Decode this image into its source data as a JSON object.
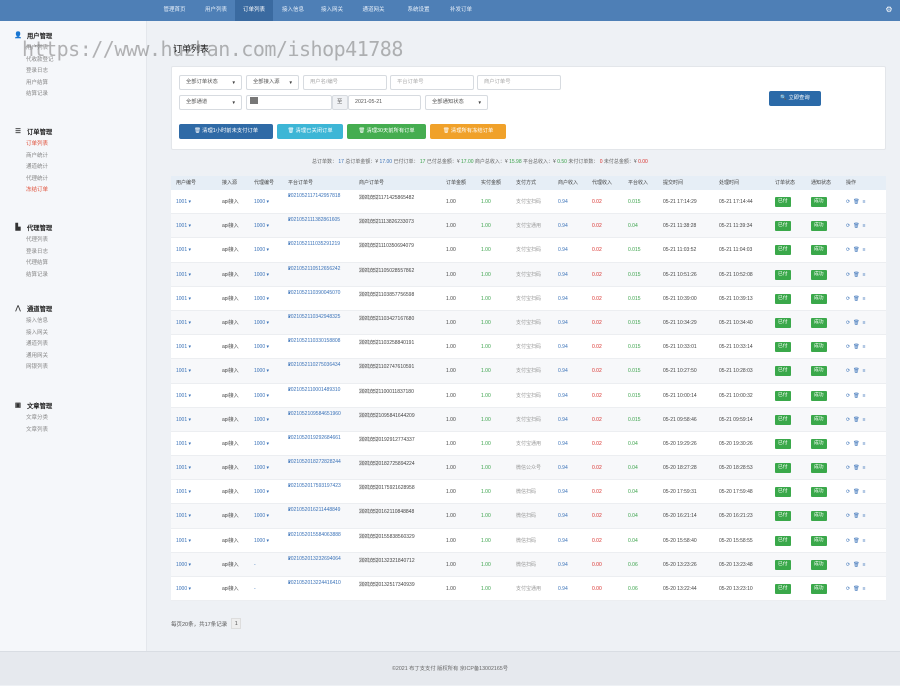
{
  "topnav": {
    "items": [
      {
        "label": "管理首页",
        "active": false
      },
      {
        "label": "用户列表",
        "active": false
      },
      {
        "label": "订单列表",
        "active": true
      },
      {
        "label": "接入信息",
        "active": false
      },
      {
        "label": "接入网关",
        "active": false
      },
      {
        "label": "通道网关",
        "active": false
      },
      {
        "label": "系统设置",
        "active": false
      },
      {
        "label": "补发订单",
        "active": false
      }
    ],
    "settings_icon": "gear-icon"
  },
  "sidebar": {
    "sections": [
      {
        "title": "用户管理",
        "icon": "user-icon",
        "items": [
          {
            "label": "用户列表",
            "current": false
          },
          {
            "label": "代收款登记",
            "current": false
          },
          {
            "label": "登录日志",
            "current": false
          },
          {
            "label": "用户结算",
            "current": false
          },
          {
            "label": "结算记录",
            "current": false
          }
        ]
      },
      {
        "title": "订单管理",
        "icon": "list-icon",
        "items": [
          {
            "label": "订单列表",
            "current": true
          },
          {
            "label": "商户统计",
            "current": false
          },
          {
            "label": "通道统计",
            "current": false
          },
          {
            "label": "代理统计",
            "current": false
          },
          {
            "label": "冻结订单",
            "current": true
          }
        ]
      },
      {
        "title": "代理管理",
        "icon": "document-icon",
        "items": [
          {
            "label": "代理列表",
            "current": false
          },
          {
            "label": "登录日志",
            "current": false
          },
          {
            "label": "代理结算",
            "current": false
          },
          {
            "label": "结算记录",
            "current": false
          }
        ]
      },
      {
        "title": "通道管理",
        "icon": "road-icon",
        "items": [
          {
            "label": "接入信息",
            "current": false
          },
          {
            "label": "接入网关",
            "current": false
          },
          {
            "label": "通道列表",
            "current": false
          },
          {
            "label": "通用网关",
            "current": false
          },
          {
            "label": "网银列表",
            "current": false
          }
        ]
      },
      {
        "title": "文章管理",
        "icon": "book-icon",
        "items": [
          {
            "label": "文章分类",
            "current": false
          },
          {
            "label": "文章列表",
            "current": false
          }
        ]
      }
    ]
  },
  "watermark": "https://www.huzhan.com/ishop41788",
  "page_title": "订单列表",
  "filters": {
    "order_status": "全部订单状态",
    "access_type": "全部接入源",
    "user_placeholder": "用户名/编号",
    "platform_no_placeholder": "平台订单号",
    "merchant_no_placeholder": "商户订单号",
    "channel": "全部通道",
    "date_from": "",
    "date_sep": "至",
    "date_to": "2021-05-21",
    "notify_status": "全部通知状态",
    "query_button": "立即查询",
    "query_icon": "search-icon"
  },
  "cleanup_buttons": [
    {
      "label": "清理1小时前未支付订单",
      "color": "#2f6aa6",
      "icon": "trash-icon"
    },
    {
      "label": "清理已关闭订单",
      "color": "#3db6d6",
      "icon": "trash-icon"
    },
    {
      "label": "清理30天前所有订单",
      "color": "#45ad50",
      "icon": "trash-icon"
    },
    {
      "label": "清理所有冻结订单",
      "color": "#f0a12a",
      "icon": "trash-icon"
    }
  ],
  "stats": [
    {
      "label": "总订单数：",
      "value": "17",
      "color": "#3a72b8"
    },
    {
      "label": "总订单金额：¥",
      "value": "17.00",
      "color": "#3a72b8"
    },
    {
      "label": "已付订单：",
      "value": "17",
      "color": "#3aa24a"
    },
    {
      "label": "已付总金额：¥",
      "value": "17.00",
      "color": "#3aa24a"
    },
    {
      "label": "商户总收入：¥",
      "value": "15.98",
      "color": "#3aa24a"
    },
    {
      "label": "平台总收入：¥",
      "value": "0.50",
      "color": "#3aa24a"
    },
    {
      "label": "未付订单数：",
      "value": "0",
      "color": "#d9302c"
    },
    {
      "label": "未付总金额：¥",
      "value": "0.00",
      "color": "#d9302c"
    }
  ],
  "table": {
    "headers": [
      "用户编号",
      "接入源",
      "代理编号",
      "平台订单号",
      "商户订单号",
      "订单金额",
      "实付金额",
      "支付方式",
      "商户收入",
      "代理收入",
      "平台收入",
      "提交时间",
      "处理时间",
      "订单状态",
      "通知状态",
      "操作"
    ],
    "rows": [
      {
        "user": "1001 ▾",
        "src": "api接入",
        "agent": "1000 ▾",
        "pno": "20210521171429578​18",
        "pno1": "2021052117142957818",
        "mno1": "20210521171425865482",
        "mno2": "测试支付",
        "amt": "1.00",
        "paid": "1.00",
        "pay": "支付宝扫码",
        "minc": "0.94",
        "ainc": "0.02",
        "pinc": "0.015",
        "sub": "05-21 17:14:29",
        "proc": "05-21 17:14:44",
        "status": "已付",
        "notify": "成功"
      },
      {
        "user": "1001 ▾",
        "src": "api接入",
        "agent": "1000 ▾",
        "pno1": "2021052111382861605",
        "mno1": "20210521113826233073",
        "mno2": "测试支付",
        "amt": "1.00",
        "paid": "1.00",
        "pay": "支付宝通用",
        "minc": "0.94",
        "ainc": "0.02",
        "pinc": "0.04",
        "sub": "05-21 11:38:28",
        "proc": "05-21 11:39:34",
        "status": "已付",
        "notify": "成功"
      },
      {
        "user": "1001 ▾",
        "src": "api接入",
        "agent": "1000 ▾",
        "pno1": "2021052111035291219",
        "mno1": "20210521110350694079",
        "mno2": "测试支付",
        "amt": "1.00",
        "paid": "1.00",
        "pay": "支付宝扫码",
        "minc": "0.94",
        "ainc": "0.02",
        "pinc": "0.015",
        "sub": "05-21 11:03:52",
        "proc": "05-21 11:04:03",
        "status": "已付",
        "notify": "成功"
      },
      {
        "user": "1001 ▾",
        "src": "api接入",
        "agent": "1000 ▾",
        "pno1": "2021052110512656242",
        "mno1": "20210521105028557862",
        "mno2": "测试支付",
        "amt": "1.00",
        "paid": "1.00",
        "pay": "支付宝扫码",
        "minc": "0.94",
        "ainc": "0.02",
        "pinc": "0.015",
        "sub": "05-21 10:51:26",
        "proc": "05-21 10:52:08",
        "status": "已付",
        "notify": "成功"
      },
      {
        "user": "1001 ▾",
        "src": "api接入",
        "agent": "1000 ▾",
        "pno1": "2021052110390045070",
        "mno1": "20210521103857756598",
        "mno2": "测试支付",
        "amt": "1.00",
        "paid": "1.00",
        "pay": "支付宝扫码",
        "minc": "0.94",
        "ainc": "0.02",
        "pinc": "0.015",
        "sub": "05-21 10:39:00",
        "proc": "05-21 10:39:13",
        "status": "已付",
        "notify": "成功"
      },
      {
        "user": "1001 ▾",
        "src": "api接入",
        "agent": "1000 ▾",
        "pno1": "2021052110342948325",
        "mno1": "20210521103427167680",
        "mno2": "测试支付",
        "amt": "1.00",
        "paid": "1.00",
        "pay": "支付宝扫码",
        "minc": "0.94",
        "ainc": "0.02",
        "pinc": "0.015",
        "sub": "05-21 10:34:29",
        "proc": "05-21 10:34:40",
        "status": "已付",
        "notify": "成功"
      },
      {
        "user": "1001 ▾",
        "src": "api接入",
        "agent": "1000 ▾",
        "pno1": "2021052110330158808",
        "mno1": "20210521103258840191",
        "mno2": "测试支付",
        "amt": "1.00",
        "paid": "1.00",
        "pay": "支付宝扫码",
        "minc": "0.94",
        "ainc": "0.02",
        "pinc": "0.015",
        "sub": "05-21 10:33:01",
        "proc": "05-21 10:33:14",
        "status": "已付",
        "notify": "成功"
      },
      {
        "user": "1001 ▾",
        "src": "api接入",
        "agent": "1000 ▾",
        "pno1": "2021052110275036434",
        "mno1": "20210521102747610591",
        "mno2": "测试支付",
        "amt": "1.00",
        "paid": "1.00",
        "pay": "支付宝扫码",
        "minc": "0.94",
        "ainc": "0.02",
        "pinc": "0.015",
        "sub": "05-21 10:27:50",
        "proc": "05-21 10:28:03",
        "status": "已付",
        "notify": "成功"
      },
      {
        "user": "1001 ▾",
        "src": "api接入",
        "agent": "1000 ▾",
        "pno1": "2021052110001489310",
        "mno1": "20210521100011837180",
        "mno2": "测试支付",
        "amt": "1.00",
        "paid": "1.00",
        "pay": "支付宝扫码",
        "minc": "0.94",
        "ainc": "0.02",
        "pinc": "0.015",
        "sub": "05-21 10:00:14",
        "proc": "05-21 10:00:32",
        "status": "已付",
        "notify": "成功"
      },
      {
        "user": "1001 ▾",
        "src": "api接入",
        "agent": "1000 ▾",
        "pno1": "2021052109584651960",
        "mno1": "20210521095841644209",
        "mno2": "测试支付",
        "amt": "1.00",
        "paid": "1.00",
        "pay": "支付宝扫码",
        "minc": "0.94",
        "ainc": "0.02",
        "pinc": "0.015",
        "sub": "05-21 09:58:46",
        "proc": "05-21 09:59:14",
        "status": "已付",
        "notify": "成功"
      },
      {
        "user": "1001 ▾",
        "src": "api接入",
        "agent": "1000 ▾",
        "pno1": "2021052019292684661",
        "mno1": "20210520192912774337",
        "mno2": "测试支付",
        "amt": "1.00",
        "paid": "1.00",
        "pay": "支付宝通用",
        "minc": "0.94",
        "ainc": "0.02",
        "pinc": "0.04",
        "sub": "05-20 19:29:26",
        "proc": "05-20 19:30:26",
        "status": "已付",
        "notify": "成功"
      },
      {
        "user": "1001 ▾",
        "src": "api接入",
        "agent": "1000 ▾",
        "pno1": "2021052018272828244",
        "mno1": "20210520182725894224",
        "mno2": "测试支付",
        "amt": "1.00",
        "paid": "1.00",
        "pay": "微信公众号",
        "minc": "0.94",
        "ainc": "0.02",
        "pinc": "0.04",
        "sub": "05-20 18:27:28",
        "proc": "05-20 18:28:53",
        "status": "已付",
        "notify": "成功"
      },
      {
        "user": "1001 ▾",
        "src": "api接入",
        "agent": "1000 ▾",
        "pno1": "2021052017593197423",
        "mno1": "20210520175921628958",
        "mno2": "测试支付",
        "amt": "1.00",
        "paid": "1.00",
        "pay": "微信扫码",
        "minc": "0.94",
        "ainc": "0.02",
        "pinc": "0.04",
        "sub": "05-20 17:59:31",
        "proc": "05-20 17:59:48",
        "status": "已付",
        "notify": "成功"
      },
      {
        "user": "1001 ▾",
        "src": "api接入",
        "agent": "1000 ▾",
        "pno1": "2021052016211448849",
        "mno1": "20210520162110848848",
        "mno2": "测试支付",
        "amt": "1.00",
        "paid": "1.00",
        "pay": "微信扫码",
        "minc": "0.94",
        "ainc": "0.02",
        "pinc": "0.04",
        "sub": "05-20 16:21:14",
        "proc": "05-20 16:21:23",
        "status": "已付",
        "notify": "成功"
      },
      {
        "user": "1001 ▾",
        "src": "api接入",
        "agent": "1000 ▾",
        "pno1": "2021052015584063888",
        "mno1": "20210520155838560329",
        "mno2": "测试支付",
        "amt": "1.00",
        "paid": "1.00",
        "pay": "微信扫码",
        "minc": "0.94",
        "ainc": "0.02",
        "pinc": "0.04",
        "sub": "05-20 15:58:40",
        "proc": "05-20 15:58:55",
        "status": "已付",
        "notify": "成功"
      },
      {
        "user": "1000 ▾",
        "src": "api接入",
        "agent": "-",
        "pno1": "2021052013232694064",
        "mno1": "20210520132321840712",
        "mno2": "测试支付",
        "amt": "1.00",
        "paid": "1.00",
        "pay": "微信扫码",
        "minc": "0.94",
        "ainc": "0.00",
        "pinc": "0.06",
        "sub": "05-20 13:23:26",
        "proc": "05-20 13:23:48",
        "status": "已付",
        "notify": "成功"
      },
      {
        "user": "1000 ▾",
        "src": "api接入",
        "agent": "-",
        "pno1": "2021052013224416410",
        "mno1": "20210520132517340939",
        "mno2": "测试支付",
        "amt": "1.00",
        "paid": "1.00",
        "pay": "支付宝通用",
        "minc": "0.94",
        "ainc": "0.00",
        "pinc": "0.06",
        "sub": "05-20 13:22:44",
        "proc": "05-20 13:23:10",
        "status": "已付",
        "notify": "成功"
      }
    ],
    "op_icons": "refresh-icon delete-icon detail-icon"
  },
  "pager": {
    "summary": "每页20条，共17条记录",
    "page": "1"
  },
  "footer": "©2021 布丁支支付 版权所有 京ICP备13002165号"
}
